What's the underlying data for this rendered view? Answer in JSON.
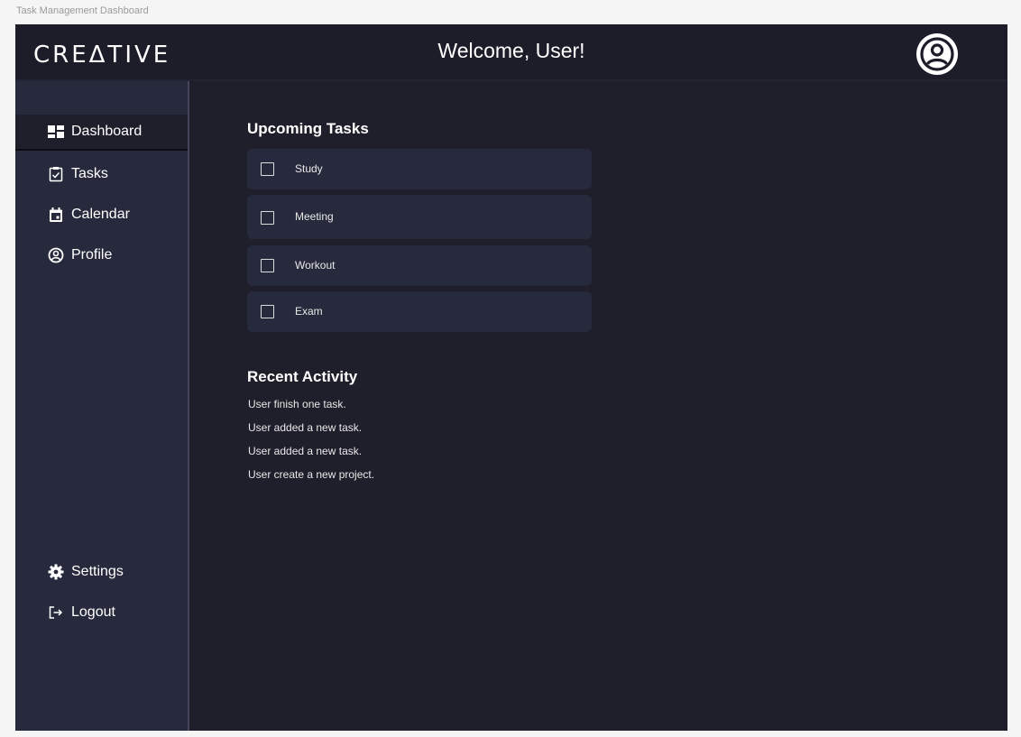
{
  "frame_label": "Task Management Dashboard",
  "header": {
    "logo": "CREΔTIVE",
    "welcome": "Welcome, User!",
    "avatar_icon": "user-circle-icon"
  },
  "sidebar": {
    "items": [
      {
        "label": "Dashboard",
        "icon": "dashboard-icon",
        "active": true
      },
      {
        "label": "Tasks",
        "icon": "clipboard-check-icon",
        "active": false
      },
      {
        "label": "Calendar",
        "icon": "calendar-icon",
        "active": false
      },
      {
        "label": "Profile",
        "icon": "user-circle-icon",
        "active": false
      }
    ],
    "bottom_items": [
      {
        "label": "Settings",
        "icon": "gear-icon"
      },
      {
        "label": "Logout",
        "icon": "logout-icon"
      }
    ]
  },
  "main": {
    "upcoming_title": "Upcoming Tasks",
    "tasks": [
      {
        "label": "Study",
        "checked": false
      },
      {
        "label": "Meeting",
        "checked": false
      },
      {
        "label": "Workout",
        "checked": false
      },
      {
        "label": "Exam",
        "checked": false
      }
    ],
    "activity_title": "Recent Activity",
    "activity": [
      "User finish one task.",
      "User added a new task.",
      "User added a new task.",
      "User create a new project."
    ]
  },
  "colors": {
    "app_bg": "#1f1f2c",
    "sidebar_bg": "#272a3c",
    "card_bg": "#272a3c",
    "text": "#ffffff"
  }
}
